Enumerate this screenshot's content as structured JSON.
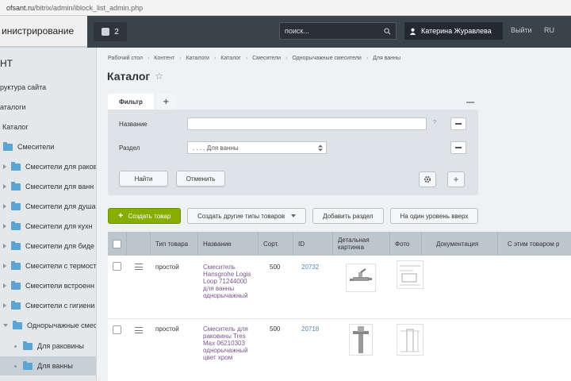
{
  "browser": {
    "url_host": "ofsant.ru",
    "url_path": "/bitrix/admin/iblock_list_admin.php"
  },
  "admin_panel": {
    "tab_label": "инистрирование",
    "notif_count": "2",
    "search_placeholder": "поиск...",
    "user_name": "Катерина Журавлева",
    "logout": "Выйти",
    "lang": "RU"
  },
  "sidebar": {
    "header": "НТ",
    "items": [
      {
        "label": "руктура сайта"
      },
      {
        "label": "аталоги"
      },
      {
        "label": "Каталог"
      },
      {
        "label": "Смесители"
      },
      {
        "label": "Смесители для раков"
      },
      {
        "label": "Смесители для ванн"
      },
      {
        "label": "Смесители для душа"
      },
      {
        "label": "Смесители для кухн"
      },
      {
        "label": "Смесители для биде"
      },
      {
        "label": "Смесители с термост"
      },
      {
        "label": "Смесители встроенн"
      },
      {
        "label": "Смесители с гигиени"
      },
      {
        "label": "Однорычажные смес"
      },
      {
        "label": "Для раковины"
      },
      {
        "label": "Для ванны"
      }
    ]
  },
  "breadcrumb": [
    "Рабочий стол",
    "Контент",
    "Каталоги",
    "Каталог",
    "Смесители",
    "Однорычажные смесители",
    "Для ванны"
  ],
  "page_title": "Каталог",
  "filter": {
    "tab_label": "Фильтр",
    "name_label": "Название",
    "section_label": "Раздел",
    "section_value": ". . . . Для ванны",
    "help": "?",
    "find_button": "Найти",
    "cancel_button": "Отменить"
  },
  "actions": {
    "create_product": "Создать товар",
    "create_other": "Создать другие типы товаров",
    "add_section": "Добавить раздел",
    "level_up": "На один уровень вверх"
  },
  "table": {
    "columns": [
      "Тип товара",
      "Название",
      "Сорт.",
      "ID",
      "Детальная картинка",
      "Фото",
      "Документация",
      "С этим товаром р"
    ],
    "rows": [
      {
        "type": "простой",
        "name": "Смеситель Hansgrohe Logis Loop 71244000 для ванны однорычажный",
        "sort": "500",
        "id": "20732"
      },
      {
        "type": "простой",
        "name": "Смеситель для раковины Tres Max 06210303 однорычажный цвет хром",
        "sort": "500",
        "id": "20718"
      }
    ]
  }
}
